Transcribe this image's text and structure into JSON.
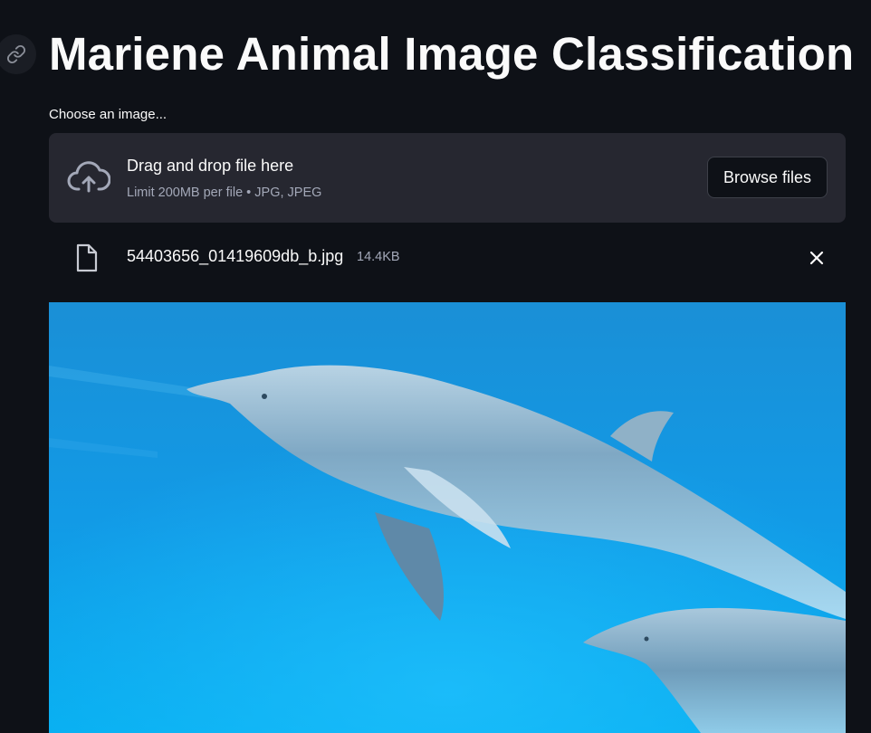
{
  "header": {
    "title": "Mariene Animal Image Classification"
  },
  "uploader": {
    "label": "Choose an image...",
    "dropzone_title": "Drag and drop file here",
    "dropzone_limit": "Limit 200MB per file • JPG, JPEG",
    "browse_label": "Browse files"
  },
  "uploaded_file": {
    "name": "54403656_01419609db_b.jpg",
    "size": "14.4KB"
  },
  "icons": {
    "anchor": "link-icon",
    "upload": "cloud-upload-icon",
    "file": "file-icon",
    "remove": "close-icon"
  },
  "colors": {
    "background": "#0e1117",
    "dropzone": "#262730",
    "muted_text": "#a3a8b8"
  }
}
